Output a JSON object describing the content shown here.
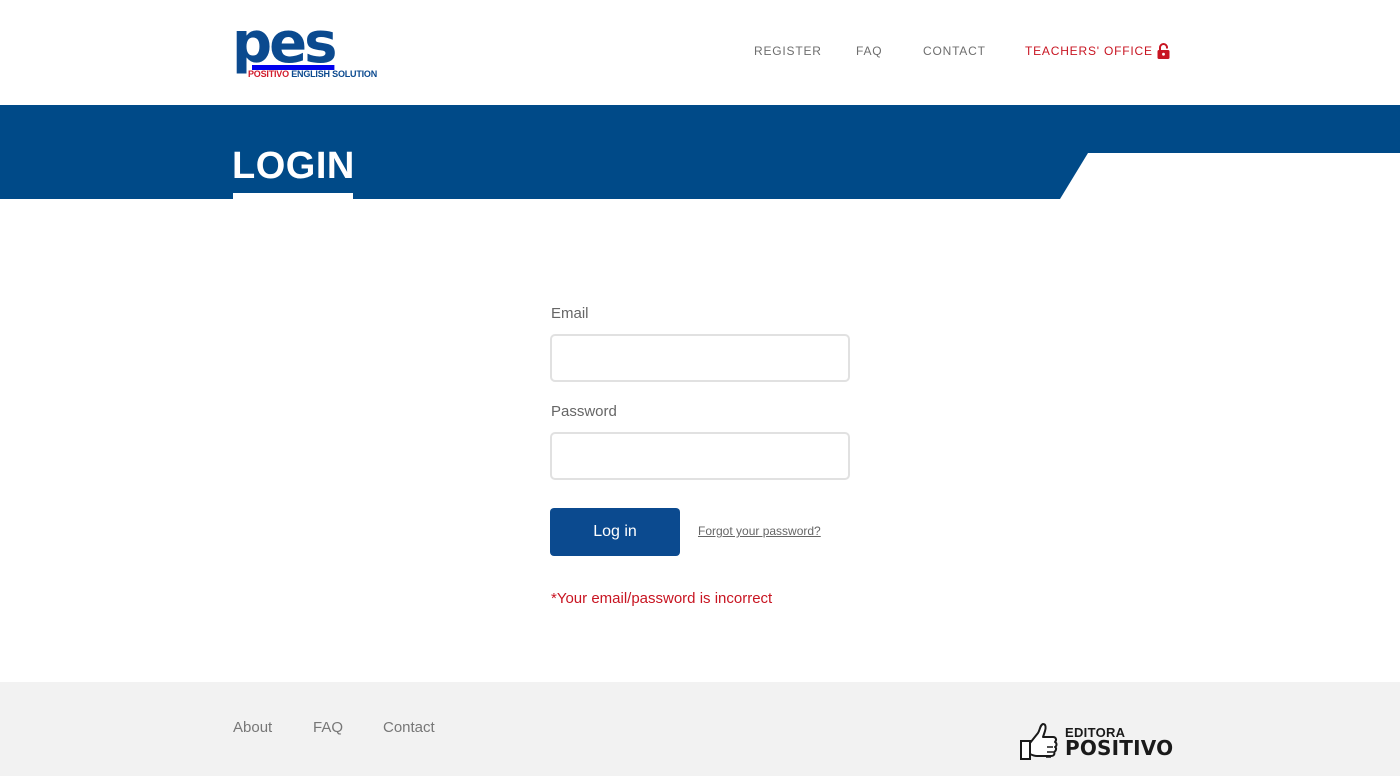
{
  "header": {
    "logo_mark": "pes",
    "logo_sub_red": "POSITIVO",
    "logo_sub_blue": "ENGLISH SOLUTION",
    "nav": {
      "register": "REGISTER",
      "faq": "FAQ",
      "contact": "CONTACT",
      "teachers_office": "TEACHERS' OFFICE"
    },
    "lock_icon": "lock-icon"
  },
  "banner": {
    "title": "LOGIN"
  },
  "form": {
    "email_label": "Email",
    "email_value": "",
    "password_label": "Password",
    "password_value": "",
    "login_button": "Log in",
    "forgot_link": "Forgot your password?",
    "error_message": "*Your email/password is incorrect"
  },
  "footer": {
    "links": {
      "about": "About",
      "faq": "FAQ",
      "contact": "Contact"
    },
    "brand_top": "EDITORA",
    "brand_bottom": "POSITIVO",
    "brand_icon": "thumbs-up-icon"
  },
  "colors": {
    "brand_blue": "#004a88",
    "button_blue": "#0b4a8f",
    "accent_red": "#c81522",
    "footer_bg": "#f2f2f2"
  }
}
